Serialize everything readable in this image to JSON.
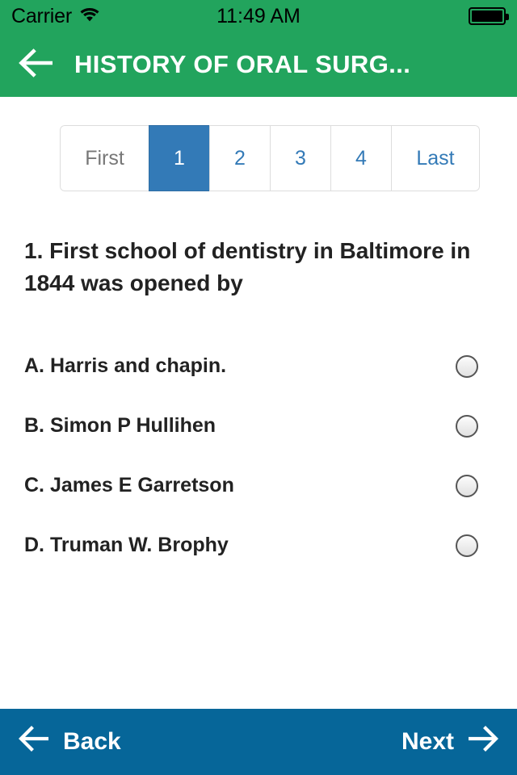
{
  "status_bar": {
    "carrier": "Carrier",
    "wifi_icon": "wifi-icon",
    "time": "11:49 AM",
    "battery_icon": "battery-full-icon"
  },
  "nav_bar": {
    "back_icon": "arrow-left-icon",
    "title": "HISTORY OF ORAL SURG..."
  },
  "pagination": {
    "items": [
      {
        "label": "First",
        "state": "disabled"
      },
      {
        "label": "1",
        "state": "active"
      },
      {
        "label": "2",
        "state": "link"
      },
      {
        "label": "3",
        "state": "link"
      },
      {
        "label": "4",
        "state": "link"
      },
      {
        "label": "Last",
        "state": "link"
      }
    ],
    "current_page": "1",
    "active_color": "#337ab7",
    "link_color": "#337ab7",
    "disabled_color": "#777777"
  },
  "question": {
    "number": "1",
    "text": "1. First school of dentistry in Baltimore in 1844 was opened by"
  },
  "options": [
    {
      "label": "A. Harris and chapin.",
      "selected": false
    },
    {
      "label": "B. Simon P Hullihen",
      "selected": false
    },
    {
      "label": "C. James E Garretson",
      "selected": false
    },
    {
      "label": "D. Truman W. Brophy",
      "selected": false
    }
  ],
  "bottom_bar": {
    "back_label": "Back",
    "back_icon": "arrow-left-icon",
    "next_label": "Next",
    "next_icon": "arrow-right-icon",
    "background_color": "#066699"
  },
  "theme": {
    "header_green": "#22a45d",
    "footer_blue": "#066699",
    "text_dark": "#222222"
  }
}
